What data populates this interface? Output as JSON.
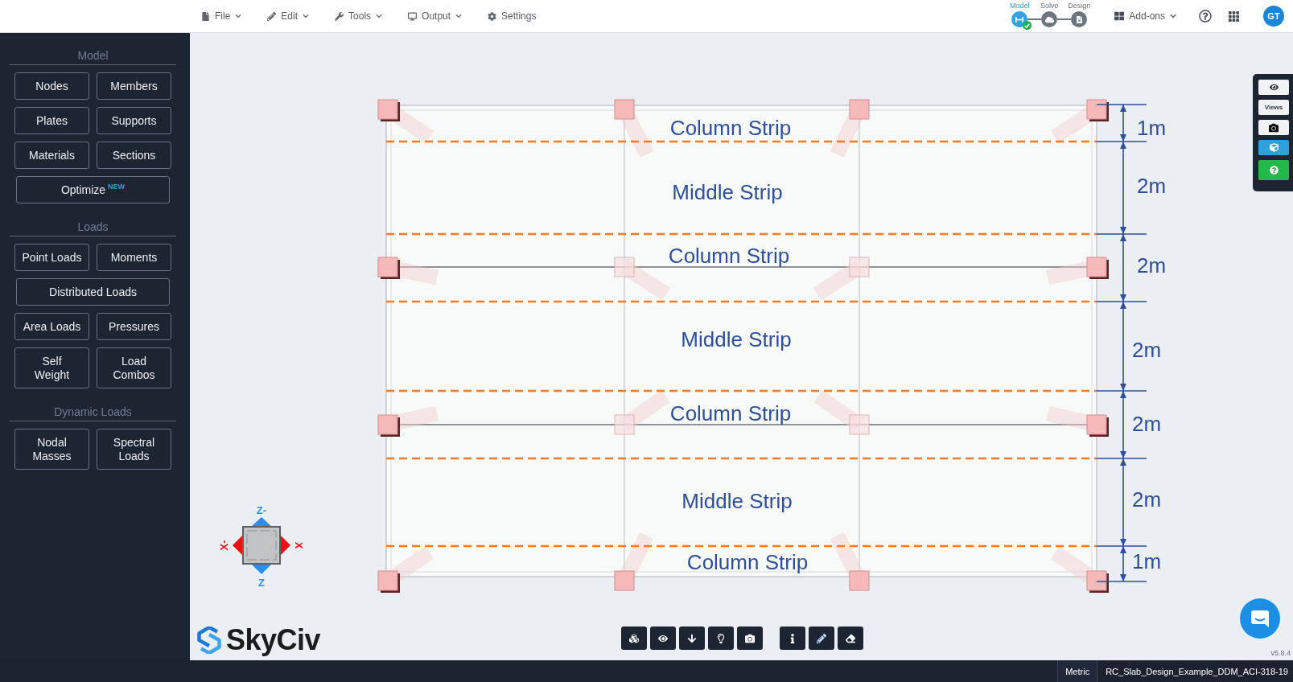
{
  "top_bar": {
    "menus": [
      {
        "label": "File",
        "has_dropdown": true
      },
      {
        "label": "Edit",
        "has_dropdown": true
      },
      {
        "label": "Tools",
        "has_dropdown": true
      },
      {
        "label": "Output",
        "has_dropdown": true
      },
      {
        "label": "Settings",
        "has_dropdown": false
      }
    ],
    "workflow_steps": [
      {
        "label": "Model",
        "selected": true,
        "completed": true
      },
      {
        "label": "Solve",
        "selected": false,
        "completed": false
      },
      {
        "label": "Design",
        "selected": false,
        "completed": false
      }
    ],
    "addons": {
      "label": "Add-ons"
    },
    "user": {
      "initials": "GT"
    }
  },
  "sidebar": {
    "sections": [
      {
        "title": "Model",
        "rows": [
          [
            {
              "label": "Nodes"
            },
            {
              "label": "Members"
            }
          ],
          [
            {
              "label": "Plates"
            },
            {
              "label": "Supports"
            }
          ],
          [
            {
              "label": "Materials"
            },
            {
              "label": "Sections"
            }
          ],
          [
            {
              "label": "Optimize",
              "badge": "NEW"
            }
          ]
        ]
      },
      {
        "title": "Loads",
        "rows": [
          [
            {
              "label": "Point Loads"
            },
            {
              "label": "Moments"
            }
          ],
          [
            {
              "label": "Distributed Loads"
            }
          ],
          [
            {
              "label": "Area Loads"
            },
            {
              "label": "Pressures"
            }
          ],
          [
            {
              "label": "Self\nWeight"
            },
            {
              "label": "Load\nCombos"
            }
          ]
        ]
      },
      {
        "title": "Dynamic Loads",
        "rows": [
          [
            {
              "label": "Nodal\nMasses"
            },
            {
              "label": "Spectral\nLoads"
            }
          ]
        ]
      }
    ]
  },
  "viewport": {
    "strip_labels": [
      "Column Strip",
      "Middle Strip",
      "Column Strip",
      "Middle Strip",
      "Column Strip",
      "Middle Strip",
      "Column Strip"
    ],
    "dimension_labels": [
      "1m",
      "2m",
      "2m",
      "2m",
      "2m",
      "2m",
      "1m"
    ],
    "view_cube": {
      "top": "Z-",
      "bottom": "Z",
      "left": "X-",
      "right": "X"
    },
    "logo_text": "SkyCiv",
    "side_panel": {
      "views_label": "Views"
    },
    "version": "v5.8.4"
  },
  "status_bar": {
    "units": "Metric",
    "file_name": "RC_Slab_Design_Example_DDM_ACI-318-19"
  }
}
